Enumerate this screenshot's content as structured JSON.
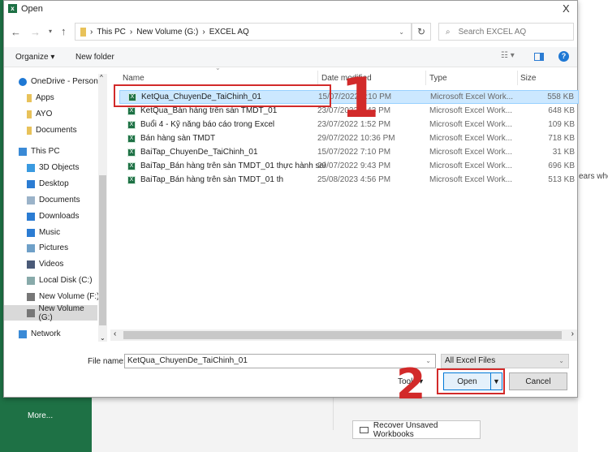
{
  "window": {
    "title": "Open",
    "close": "X"
  },
  "address": {
    "path": [
      "This PC",
      "New Volume (G:)",
      "EXCEL AQ"
    ],
    "search_placeholder": "Search EXCEL AQ"
  },
  "toolbar": {
    "organize": "Organize",
    "new_folder": "New folder",
    "help": "?"
  },
  "nav": [
    {
      "label": "OneDrive - Person",
      "icon": "cloud-icon",
      "color": "#1e78d4",
      "indent": 0
    },
    {
      "label": "Apps",
      "icon": "folder-icon",
      "color": "#e8c25a",
      "indent": 1
    },
    {
      "label": "AYO",
      "icon": "folder-icon",
      "color": "#e8c25a",
      "indent": 1
    },
    {
      "label": "Documents",
      "icon": "folder-icon",
      "color": "#e8c25a",
      "indent": 1
    },
    {
      "label": "This PC",
      "icon": "computer-icon",
      "color": "#3a8ad6",
      "indent": 0
    },
    {
      "label": "3D Objects",
      "icon": "cube-icon",
      "color": "#3a9ae0",
      "indent": 1
    },
    {
      "label": "Desktop",
      "icon": "desktop-icon",
      "color": "#2b7cd3",
      "indent": 1
    },
    {
      "label": "Documents",
      "icon": "document-icon",
      "color": "#9bb3c9",
      "indent": 1
    },
    {
      "label": "Downloads",
      "icon": "download-icon",
      "color": "#2b7cd3",
      "indent": 1
    },
    {
      "label": "Music",
      "icon": "music-icon",
      "color": "#2b7cd3",
      "indent": 1
    },
    {
      "label": "Pictures",
      "icon": "pictures-icon",
      "color": "#6fa0c8",
      "indent": 1
    },
    {
      "label": "Videos",
      "icon": "video-icon",
      "color": "#4a5a78",
      "indent": 1
    },
    {
      "label": "Local Disk (C:)",
      "icon": "disk-icon",
      "color": "#8aa",
      "indent": 1
    },
    {
      "label": "New Volume (F:)",
      "icon": "drive-icon",
      "color": "#777",
      "indent": 1
    },
    {
      "label": "New Volume (G:)",
      "icon": "drive-icon",
      "color": "#777",
      "indent": 1,
      "selected": true
    },
    {
      "label": "Network",
      "icon": "network-icon",
      "color": "#3a8ad6",
      "indent": 0
    }
  ],
  "columns": {
    "name": "Name",
    "date": "Date modified",
    "type": "Type",
    "size": "Size"
  },
  "files": [
    {
      "name": "KetQua_ChuyenDe_TaiChinh_01",
      "date": "15/07/2022 7:10 PM",
      "type": "Microsoft Excel Work...",
      "size": "558 KB",
      "selected": true
    },
    {
      "name": "KetQua_Bán hàng trên sàn TMDT_01",
      "date": "23/07/2022 4:43 PM",
      "type": "Microsoft Excel Work...",
      "size": "648 KB"
    },
    {
      "name": "Buổi 4 - Kỹ năng báo cáo trong Excel",
      "date": "23/07/2022 1:52 PM",
      "type": "Microsoft Excel Work...",
      "size": "109 KB"
    },
    {
      "name": "Bán hàng sàn TMDT",
      "date": "29/07/2022 10:36 PM",
      "type": "Microsoft Excel Work...",
      "size": "718 KB"
    },
    {
      "name": "BaiTap_ChuyenDe_TaiChinh_01",
      "date": "15/07/2022 7:10 PM",
      "type": "Microsoft Excel Work...",
      "size": "31 KB"
    },
    {
      "name": "BaiTap_Bán hàng trên sàn TMDT_01 thực hành sai",
      "date": "29/07/2022 9:43 PM",
      "type": "Microsoft Excel Work...",
      "size": "696 KB"
    },
    {
      "name": "BaiTap_Bán hàng trên sàn TMDT_01 th",
      "date": "25/08/2023 4:56 PM",
      "type": "Microsoft Excel Work...",
      "size": "513 KB"
    }
  ],
  "footer": {
    "file_name_label": "File name:",
    "file_name_value": "KetQua_ChuyenDe_TaiChinh_01",
    "filter": "All Excel Files",
    "tools": "Tools",
    "open": "Open",
    "cancel": "Cancel"
  },
  "background": {
    "more": "More...",
    "recover": "Recover Unsaved Workbooks",
    "partial_text": "ears whe"
  },
  "annotations": {
    "step1": "1",
    "step2": "2",
    "color": "#d22a2a"
  }
}
